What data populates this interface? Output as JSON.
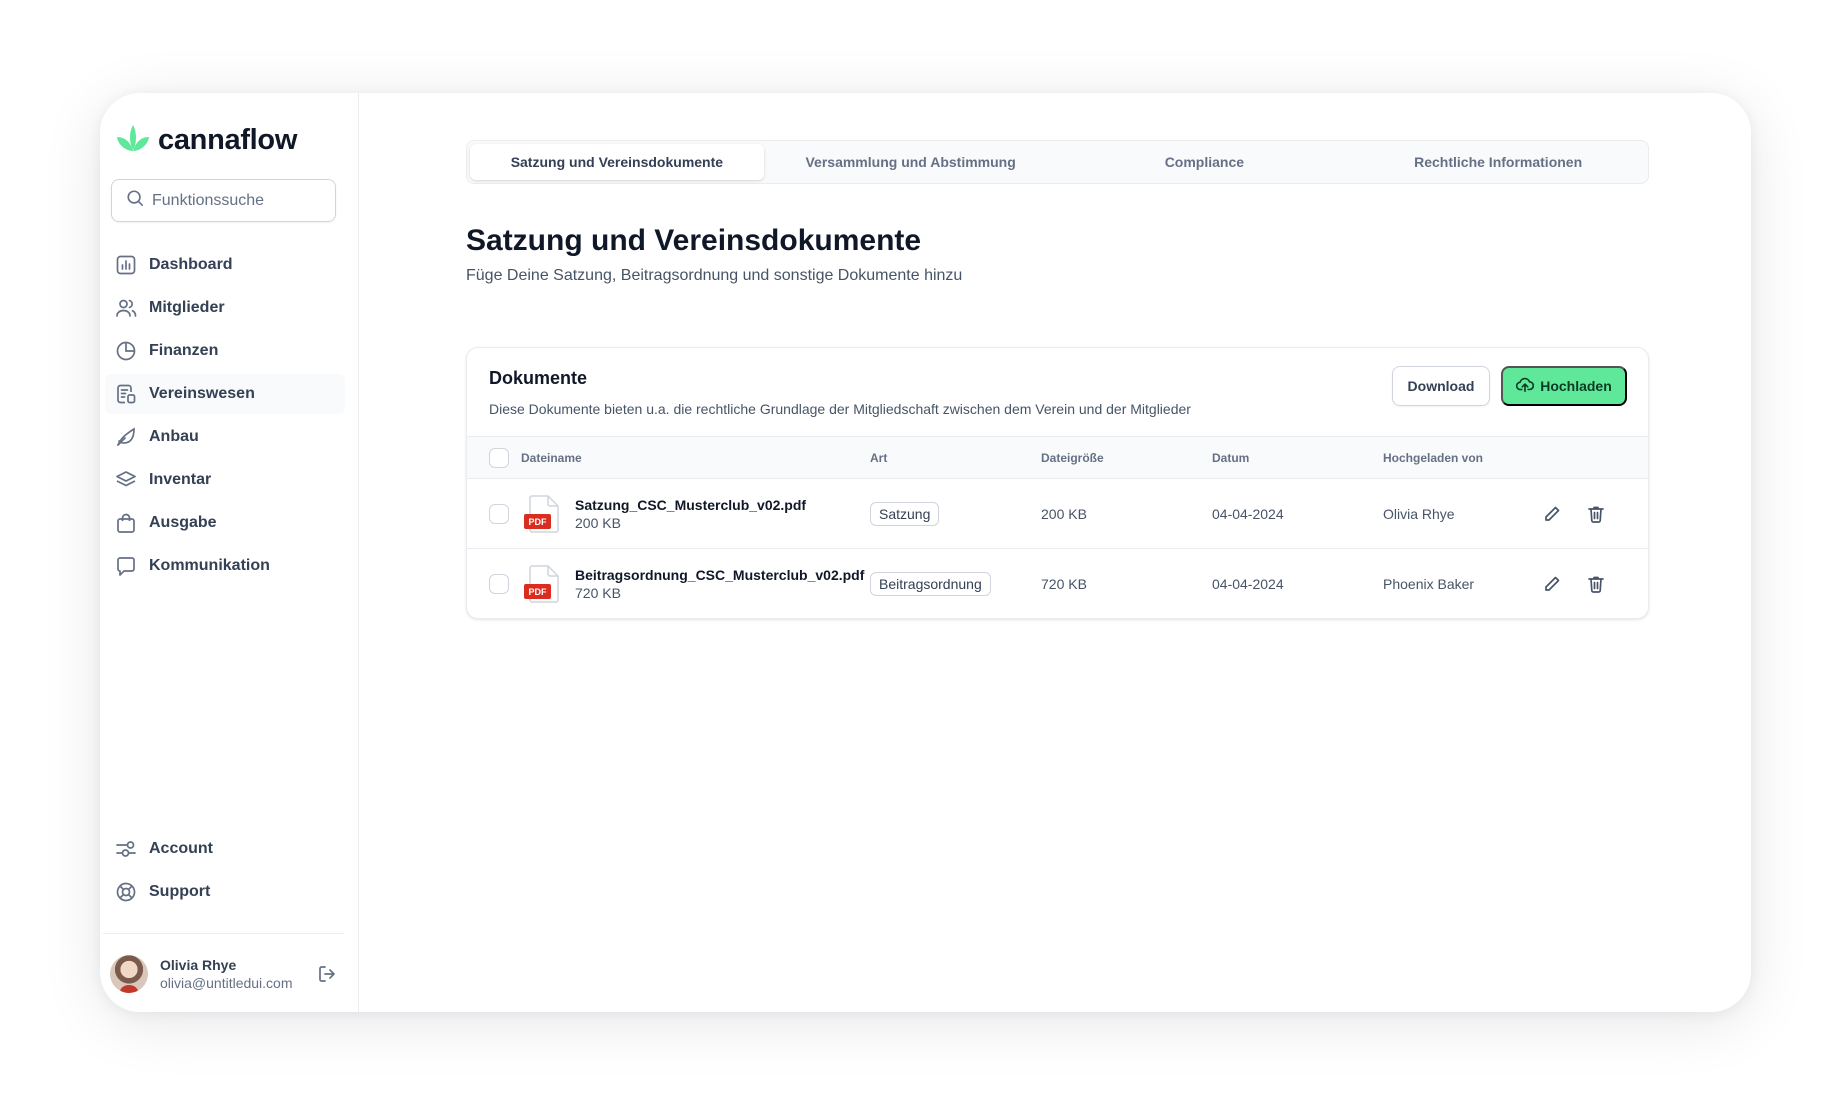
{
  "app": {
    "brand": "cannaflow",
    "brand_color": "#5fe89a"
  },
  "search": {
    "placeholder": "Funktionssuche"
  },
  "sidebar": {
    "items": [
      {
        "label": "Dashboard",
        "icon": "bar-chart-icon"
      },
      {
        "label": "Mitglieder",
        "icon": "users-icon"
      },
      {
        "label": "Finanzen",
        "icon": "pie-chart-icon"
      },
      {
        "label": "Vereinswesen",
        "icon": "document-icon",
        "active": true
      },
      {
        "label": "Anbau",
        "icon": "leaf-icon"
      },
      {
        "label": "Inventar",
        "icon": "layers-icon"
      },
      {
        "label": "Ausgabe",
        "icon": "shopping-bag-icon"
      },
      {
        "label": "Kommunikation",
        "icon": "message-icon"
      }
    ],
    "bottom_items": [
      {
        "label": "Account",
        "icon": "settings-toggle-icon"
      },
      {
        "label": "Support",
        "icon": "life-buoy-icon"
      }
    ]
  },
  "user": {
    "name": "Olivia Rhye",
    "email": "olivia@untitledui.com"
  },
  "tabs": [
    {
      "label": "Satzung und Vereinsdokumente",
      "active": true
    },
    {
      "label": "Versammlung und Abstimmung"
    },
    {
      "label": "Compliance"
    },
    {
      "label": "Rechtliche Informationen"
    }
  ],
  "page": {
    "title": "Satzung und Vereinsdokumente",
    "subtitle": "Füge Deine Satzung, Beitragsordnung und sonstige Dokumente hinzu"
  },
  "documents": {
    "title": "Dokumente",
    "description": "Diese Dokumente bieten u.a. die rechtliche Grundlage der Mitgliedschaft zwischen dem Verein und der Mitglieder",
    "download_label": "Download",
    "upload_label": "Hochladen",
    "columns": {
      "name": "Dateiname",
      "type": "Art",
      "size": "Dateigröße",
      "date": "Datum",
      "uploaded_by": "Hochgeladen von"
    },
    "file_badge": "PDF",
    "rows": [
      {
        "name": "Satzung_CSC_Musterclub_v02.pdf",
        "size_sub": "200 KB",
        "type": "Satzung",
        "size": "200 KB",
        "date": "04-04-2024",
        "uploaded_by": "Olivia Rhye"
      },
      {
        "name": "Beitragsordnung_CSC_Musterclub_v02.pdf",
        "size_sub": "720 KB",
        "type": "Beitragsordnung",
        "size": "720 KB",
        "date": "04-04-2024",
        "uploaded_by": "Phoenix Baker"
      }
    ]
  }
}
